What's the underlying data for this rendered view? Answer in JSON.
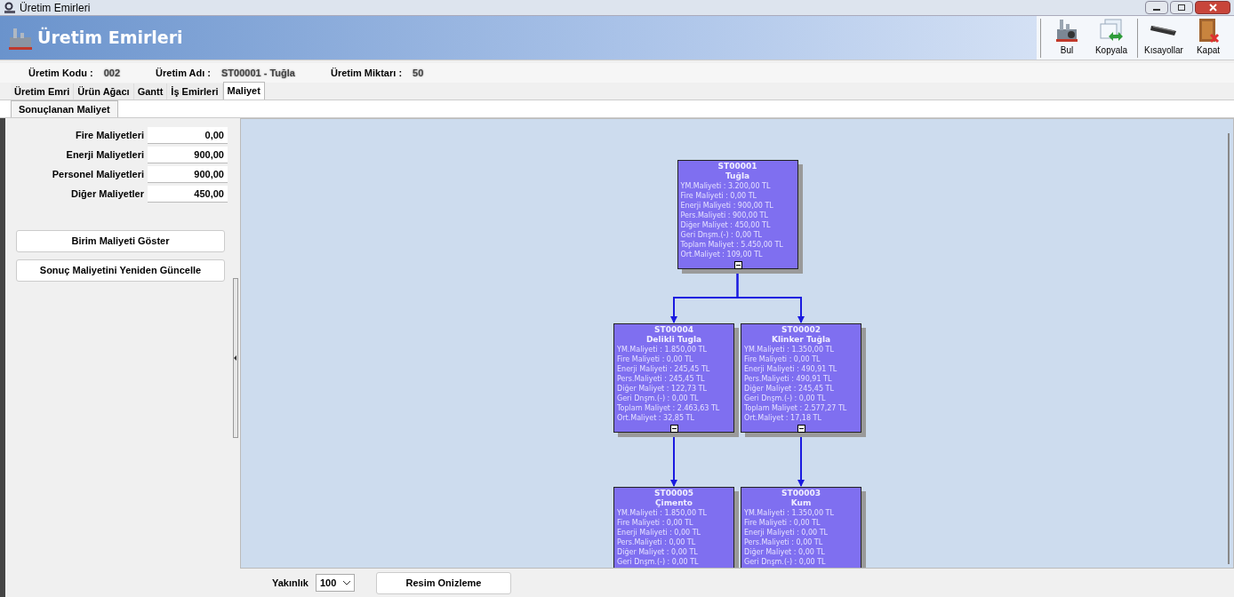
{
  "window": {
    "title": "Üretim Emirleri"
  },
  "banner": {
    "title": "Üretim Emirleri"
  },
  "toolbar": [
    {
      "label": "Bul",
      "kind": "factory"
    },
    {
      "label": "Kopyala",
      "kind": "copy"
    },
    {
      "label": "Kısayollar",
      "kind": "keyboard"
    },
    {
      "label": "Kapat",
      "kind": "door"
    }
  ],
  "info": [
    {
      "label": "Üretim Kodu  :",
      "value": "002"
    },
    {
      "label": "Üretim Adı  :",
      "value": "ST00001 - Tuğla"
    },
    {
      "label": "Üretim Miktarı  :",
      "value": "50"
    }
  ],
  "tabs": [
    {
      "label": "Üretim Emri",
      "selected": false
    },
    {
      "label": "Ürün Ağacı",
      "selected": false
    },
    {
      "label": "Gantt",
      "selected": false
    },
    {
      "label": "İş Emirleri",
      "selected": false
    },
    {
      "label": "Maliyet",
      "selected": true
    }
  ],
  "subtabs": [
    {
      "label": "Sonuçlanan Maliyet",
      "selected": true
    }
  ],
  "costs": [
    {
      "label": "Fire Maliyetleri",
      "value": "0,00"
    },
    {
      "label": "Enerji Maliyetleri",
      "value": "900,00"
    },
    {
      "label": "Personel Maliyetleri",
      "value": "900,00"
    },
    {
      "label": "Diğer Maliyetler",
      "value": "450,00"
    }
  ],
  "buttons": [
    "Birim Maliyeti Göster",
    "Sonuç Maliyetini Yeniden Güncelle"
  ],
  "tree": {
    "code": "ST00001",
    "name": "Tuğla",
    "expanded": true,
    "lines": [
      "YM.Maliyeti : 3.200,00 TL",
      "Fire Maliyeti : 0,00 TL",
      "Enerji Maliyeti : 900,00 TL",
      "Pers.Maliyeti : 900,00 TL",
      "Diğer Maliyet : 450,00 TL",
      "Geri Dnşm.(-) : 0,00 TL",
      "Toplam Maliyet : 5.450,00 TL",
      "Ort.Maliyet : 109,00 TL"
    ],
    "children": [
      {
        "code": "ST00004",
        "name": "Delikli Tugla",
        "expanded": true,
        "lines": [
          "YM.Maliyeti : 1.850,00 TL",
          "Fire Maliyeti : 0,00 TL",
          "Enerji Maliyeti : 245,45 TL",
          "Pers.Maliyeti : 245,45 TL",
          "Diğer Maliyet : 122,73 TL",
          "Geri Dnşm.(-) : 0,00 TL",
          "Toplam Maliyet : 2.463,63 TL",
          "Ort.Maliyet : 32,85 TL"
        ],
        "children": [
          {
            "code": "ST00005",
            "name": "Çimento",
            "lines": [
              "YM.Maliyeti : 1.850,00 TL",
              "Fire Maliyeti : 0,00 TL",
              "Enerji Maliyeti : 0,00 TL",
              "Pers.Maliyeti : 0,00 TL",
              "Diğer Maliyet : 0,00 TL",
              "Geri Dnşm.(-) : 0,00 TL"
            ]
          }
        ]
      },
      {
        "code": "ST00002",
        "name": "Klinker Tuğla",
        "expanded": true,
        "lines": [
          "YM.Maliyeti : 1.350,00 TL",
          "Fire Maliyeti : 0,00 TL",
          "Enerji Maliyeti : 490,91 TL",
          "Pers.Maliyeti : 490,91 TL",
          "Diğer Maliyet : 245,45 TL",
          "Geri Dnşm.(-) : 0,00 TL",
          "Toplam Maliyet : 2.577,27 TL",
          "Ort.Maliyet : 17,18 TL"
        ],
        "children": [
          {
            "code": "ST00003",
            "name": "Kum",
            "lines": [
              "YM.Maliyeti : 1.350,00 TL",
              "Fire Maliyeti : 0,00 TL",
              "Enerji Maliyeti : 0,00 TL",
              "Pers.Maliyeti : 0,00 TL",
              "Diğer Maliyet : 0,00 TL",
              "Geri Dnşm.(-) : 0,00 TL"
            ]
          }
        ]
      }
    ]
  },
  "zoom": {
    "label": "Yakınlık",
    "value": "100"
  },
  "preview_button": "Resim Onizleme"
}
